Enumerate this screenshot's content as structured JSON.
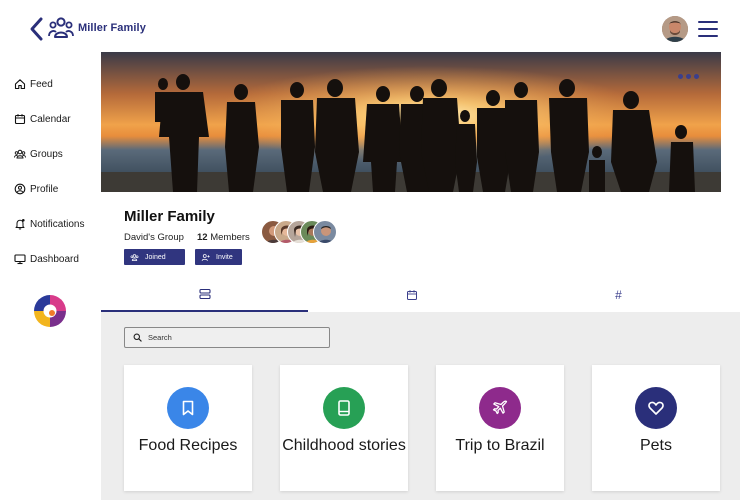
{
  "header": {
    "title": "Miller Family",
    "back_icon": "chevron-left-icon",
    "group_icon": "group-icon",
    "menu_icon": "hamburger-menu-icon"
  },
  "sidebar": {
    "items": [
      {
        "label": "Feed",
        "icon": "home-icon"
      },
      {
        "label": "Calendar",
        "icon": "calendar-icon"
      },
      {
        "label": "Groups",
        "icon": "groups-icon"
      },
      {
        "label": "Profile",
        "icon": "profile-icon"
      },
      {
        "label": "Notifications",
        "icon": "bell-icon"
      },
      {
        "label": "Dashboard",
        "icon": "monitor-icon"
      }
    ]
  },
  "group": {
    "name": "Miller Family",
    "owner": "David's Group",
    "member_count": "12",
    "members_label": "Members",
    "joined_label": "Joined",
    "invite_label": "Invite"
  },
  "tabs": [
    {
      "icon": "list-icon",
      "active": true
    },
    {
      "icon": "calendar-icon",
      "active": false
    },
    {
      "icon": "hashtag-icon",
      "label": "#",
      "active": false
    }
  ],
  "search": {
    "placeholder": "Search"
  },
  "cards": [
    {
      "label": "Food Recipes",
      "icon": "bookmark-icon",
      "color": "#3a86e8"
    },
    {
      "label": "Childhood stories",
      "icon": "book-icon",
      "color": "#27a055"
    },
    {
      "label": "Trip to Brazil",
      "icon": "plane-icon",
      "color": "#8e2a8c"
    },
    {
      "label": "Pets",
      "icon": "heart-icon",
      "color": "#2a2f7a"
    }
  ],
  "colors": {
    "brand": "#2a2f7a",
    "button": "#30357f",
    "content_bg": "#ededed"
  }
}
